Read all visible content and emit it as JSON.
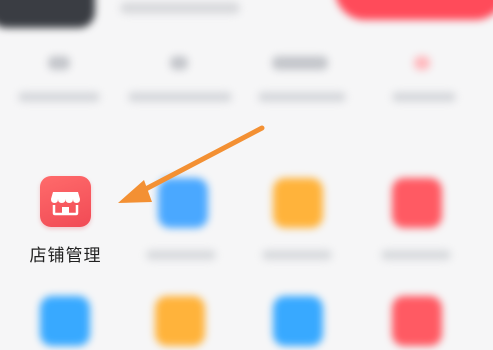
{
  "focus_item": {
    "label": "店铺管理",
    "icon": "storefront-icon",
    "color": "#f14a55"
  },
  "annotation": {
    "icon": "arrow-icon",
    "color": "#f39033"
  },
  "colors": {
    "tile_blue": "#4aa8ff",
    "tile_orange": "#ffb33b",
    "tile_red": "#ff5a63",
    "background": "#f6f6f7"
  }
}
